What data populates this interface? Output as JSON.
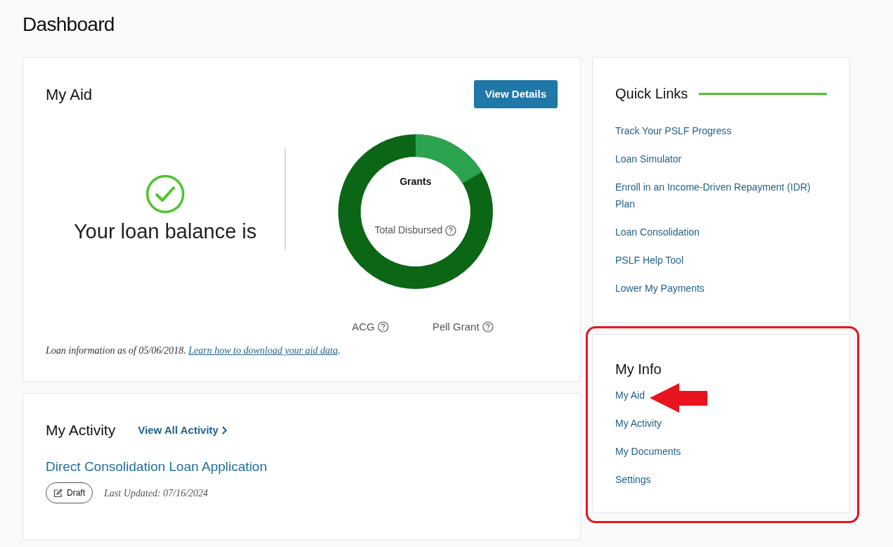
{
  "page_title": "Dashboard",
  "my_aid": {
    "title": "My Aid",
    "button": "View Details",
    "balance_text": "Your loan balance is",
    "donut_label": "Grants",
    "donut_center": "Total Disbursed",
    "legend": [
      "ACG",
      "Pell Grant"
    ],
    "footnote": "Loan information as of 05/06/2018.",
    "footnote_link": "Learn how to download your aid data",
    "footnote_end": "."
  },
  "my_activity": {
    "title": "My Activity",
    "view_all": "View All Activity",
    "items": [
      {
        "title": "Direct Consolidation Loan Application",
        "status": "Draft",
        "updated": "Last Updated: 07/16/2024"
      }
    ]
  },
  "quick_links": {
    "title": "Quick Links",
    "links": [
      "Track Your PSLF Progress",
      "Loan Simulator",
      "Enroll in an Income-Driven Repayment (IDR) Plan",
      "Loan Consolidation",
      "PSLF Help Tool",
      "Lower My Payments"
    ]
  },
  "my_info": {
    "title": "My Info",
    "links": [
      "My Aid",
      "My Activity",
      "My Documents",
      "Settings"
    ]
  }
}
